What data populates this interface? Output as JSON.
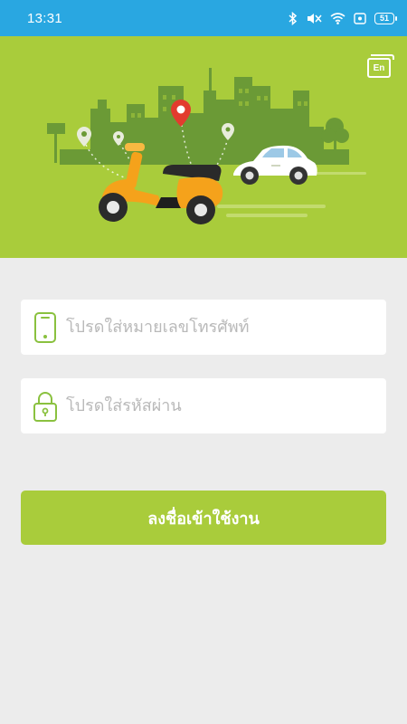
{
  "status_bar": {
    "time": "13:31",
    "battery": "51",
    "icons": [
      "bluetooth-icon",
      "mute-icon",
      "wifi-icon",
      "screen-record-icon",
      "battery-icon"
    ]
  },
  "header": {
    "language_button": "En",
    "illustration": "city-scooter-car"
  },
  "form": {
    "phone_placeholder": "โปรดใส่หมายเลขโทรศัพท์",
    "password_placeholder": "โปรดใส่รหัสผ่าน",
    "login_label": "ลงชื่อเข้าใช้งาน"
  },
  "colors": {
    "status_bar": "#29a7e1",
    "brand_green": "#a9cc3b",
    "city_green": "#6b9a36",
    "scooter_orange": "#f5a21b",
    "pin_red": "#e23b2e",
    "background": "#ececec"
  }
}
